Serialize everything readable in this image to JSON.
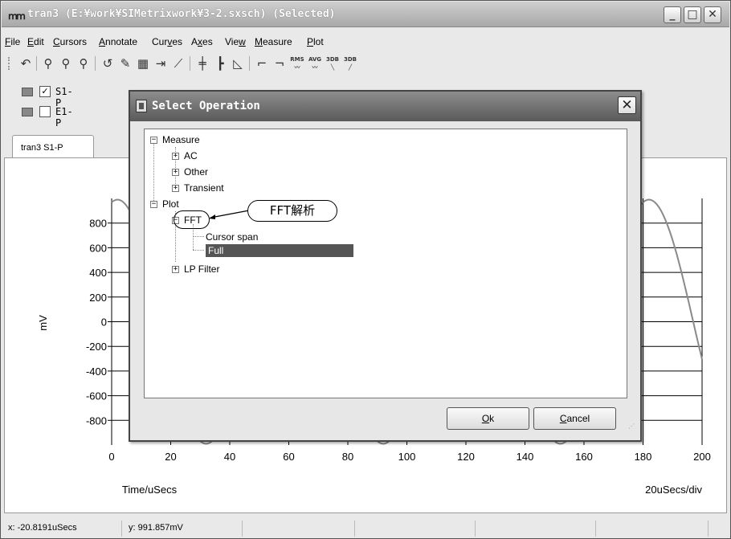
{
  "window": {
    "title": "tran3 (E:¥work¥SIMetrixwork¥3-2.sxsch) (Selected)",
    "minimize": "_",
    "maximize": "□",
    "close": "✕"
  },
  "menu": [
    {
      "pre": "",
      "u": "F",
      "post": "ile"
    },
    {
      "pre": "",
      "u": "E",
      "post": "dit"
    },
    {
      "pre": "",
      "u": "C",
      "post": "ursors"
    },
    {
      "pre": "",
      "u": "A",
      "post": "nnotate"
    },
    {
      "pre": "Cur",
      "u": "v",
      "post": "es"
    },
    {
      "pre": "A",
      "u": "x",
      "post": "es"
    },
    {
      "pre": "Vie",
      "u": "w",
      "post": ""
    },
    {
      "pre": "",
      "u": "M",
      "post": "easure"
    },
    {
      "pre": "",
      "u": "P",
      "post": "lot"
    }
  ],
  "toolbar_icons": [
    "undo-zoom-icon",
    "zoom-in-icon",
    "zoom-box-icon",
    "zoom-out-icon",
    "pan-icon",
    "annotate-abc-icon",
    "grid-abc-icon",
    "grid-arrow-icon",
    "split-axes-icon",
    "separate-grid-icon",
    "stack-icon",
    "log-axis-icon",
    "rise-edge-icon",
    "fall-edge-icon",
    "rms-icon",
    "avg-icon",
    "3db-low-icon",
    "3db-high-icon"
  ],
  "toolbar_small_labels": {
    "rms": "RMS",
    "avg": "AVG",
    "db1": "3DB",
    "db2": "3DB"
  },
  "legend": [
    {
      "label": "S1-P",
      "checked": true,
      "check_mark": "✓"
    },
    {
      "label": "E1-P",
      "checked": false,
      "check_mark": ""
    }
  ],
  "tab": {
    "label": "tran3 S1-P"
  },
  "chart_data": {
    "type": "line",
    "xlabel": "Time/uSecs",
    "ylabel": "mV",
    "x_ticks": [
      "0",
      "20",
      "40",
      "60",
      "80",
      "100",
      "120",
      "140",
      "160",
      "180",
      "200"
    ],
    "y_ticks": [
      "800",
      "600",
      "400",
      "200",
      "0",
      "-200",
      "-400",
      "-600",
      "-800"
    ],
    "xlim": [
      0,
      200
    ],
    "ylim": [
      -1000,
      1000
    ],
    "grid": true,
    "scale_note": "20uSecs/div"
  },
  "status": {
    "x": "x: -20.8191uSecs",
    "y": "y: 991.857mV"
  },
  "dialog": {
    "title": "Select Operation",
    "close": "✕",
    "tree": {
      "measure": "Measure",
      "ac": "AC",
      "other": "Other",
      "transient": "Transient",
      "plot": "Plot",
      "fft": "FFT",
      "cursor_span": "Cursor span",
      "full": "Full",
      "lp_filter": "LP Filter"
    },
    "annotation": "FFT解析",
    "ok": {
      "u": "O",
      "post": "k"
    },
    "cancel": {
      "u": "C",
      "post": "ancel"
    }
  }
}
